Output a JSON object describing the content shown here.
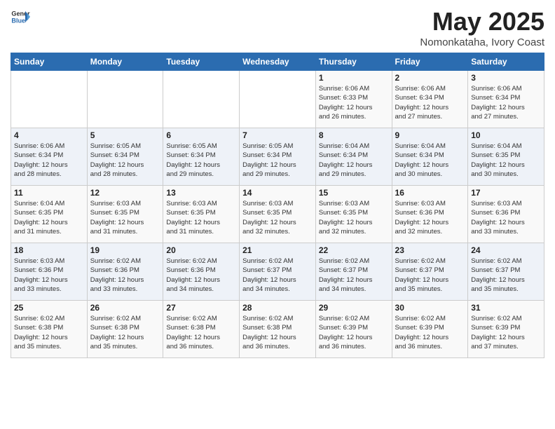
{
  "header": {
    "logo_general": "General",
    "logo_blue": "Blue",
    "title": "May 2025",
    "subtitle": "Nomonkataha, Ivory Coast"
  },
  "weekdays": [
    "Sunday",
    "Monday",
    "Tuesday",
    "Wednesday",
    "Thursday",
    "Friday",
    "Saturday"
  ],
  "weeks": [
    [
      {
        "day": "",
        "info": ""
      },
      {
        "day": "",
        "info": ""
      },
      {
        "day": "",
        "info": ""
      },
      {
        "day": "",
        "info": ""
      },
      {
        "day": "1",
        "info": "Sunrise: 6:06 AM\nSunset: 6:33 PM\nDaylight: 12 hours\nand 26 minutes."
      },
      {
        "day": "2",
        "info": "Sunrise: 6:06 AM\nSunset: 6:34 PM\nDaylight: 12 hours\nand 27 minutes."
      },
      {
        "day": "3",
        "info": "Sunrise: 6:06 AM\nSunset: 6:34 PM\nDaylight: 12 hours\nand 27 minutes."
      }
    ],
    [
      {
        "day": "4",
        "info": "Sunrise: 6:06 AM\nSunset: 6:34 PM\nDaylight: 12 hours\nand 28 minutes."
      },
      {
        "day": "5",
        "info": "Sunrise: 6:05 AM\nSunset: 6:34 PM\nDaylight: 12 hours\nand 28 minutes."
      },
      {
        "day": "6",
        "info": "Sunrise: 6:05 AM\nSunset: 6:34 PM\nDaylight: 12 hours\nand 29 minutes."
      },
      {
        "day": "7",
        "info": "Sunrise: 6:05 AM\nSunset: 6:34 PM\nDaylight: 12 hours\nand 29 minutes."
      },
      {
        "day": "8",
        "info": "Sunrise: 6:04 AM\nSunset: 6:34 PM\nDaylight: 12 hours\nand 29 minutes."
      },
      {
        "day": "9",
        "info": "Sunrise: 6:04 AM\nSunset: 6:34 PM\nDaylight: 12 hours\nand 30 minutes."
      },
      {
        "day": "10",
        "info": "Sunrise: 6:04 AM\nSunset: 6:35 PM\nDaylight: 12 hours\nand 30 minutes."
      }
    ],
    [
      {
        "day": "11",
        "info": "Sunrise: 6:04 AM\nSunset: 6:35 PM\nDaylight: 12 hours\nand 31 minutes."
      },
      {
        "day": "12",
        "info": "Sunrise: 6:03 AM\nSunset: 6:35 PM\nDaylight: 12 hours\nand 31 minutes."
      },
      {
        "day": "13",
        "info": "Sunrise: 6:03 AM\nSunset: 6:35 PM\nDaylight: 12 hours\nand 31 minutes."
      },
      {
        "day": "14",
        "info": "Sunrise: 6:03 AM\nSunset: 6:35 PM\nDaylight: 12 hours\nand 32 minutes."
      },
      {
        "day": "15",
        "info": "Sunrise: 6:03 AM\nSunset: 6:35 PM\nDaylight: 12 hours\nand 32 minutes."
      },
      {
        "day": "16",
        "info": "Sunrise: 6:03 AM\nSunset: 6:36 PM\nDaylight: 12 hours\nand 32 minutes."
      },
      {
        "day": "17",
        "info": "Sunrise: 6:03 AM\nSunset: 6:36 PM\nDaylight: 12 hours\nand 33 minutes."
      }
    ],
    [
      {
        "day": "18",
        "info": "Sunrise: 6:03 AM\nSunset: 6:36 PM\nDaylight: 12 hours\nand 33 minutes."
      },
      {
        "day": "19",
        "info": "Sunrise: 6:02 AM\nSunset: 6:36 PM\nDaylight: 12 hours\nand 33 minutes."
      },
      {
        "day": "20",
        "info": "Sunrise: 6:02 AM\nSunset: 6:36 PM\nDaylight: 12 hours\nand 34 minutes."
      },
      {
        "day": "21",
        "info": "Sunrise: 6:02 AM\nSunset: 6:37 PM\nDaylight: 12 hours\nand 34 minutes."
      },
      {
        "day": "22",
        "info": "Sunrise: 6:02 AM\nSunset: 6:37 PM\nDaylight: 12 hours\nand 34 minutes."
      },
      {
        "day": "23",
        "info": "Sunrise: 6:02 AM\nSunset: 6:37 PM\nDaylight: 12 hours\nand 35 minutes."
      },
      {
        "day": "24",
        "info": "Sunrise: 6:02 AM\nSunset: 6:37 PM\nDaylight: 12 hours\nand 35 minutes."
      }
    ],
    [
      {
        "day": "25",
        "info": "Sunrise: 6:02 AM\nSunset: 6:38 PM\nDaylight: 12 hours\nand 35 minutes."
      },
      {
        "day": "26",
        "info": "Sunrise: 6:02 AM\nSunset: 6:38 PM\nDaylight: 12 hours\nand 35 minutes."
      },
      {
        "day": "27",
        "info": "Sunrise: 6:02 AM\nSunset: 6:38 PM\nDaylight: 12 hours\nand 36 minutes."
      },
      {
        "day": "28",
        "info": "Sunrise: 6:02 AM\nSunset: 6:38 PM\nDaylight: 12 hours\nand 36 minutes."
      },
      {
        "day": "29",
        "info": "Sunrise: 6:02 AM\nSunset: 6:39 PM\nDaylight: 12 hours\nand 36 minutes."
      },
      {
        "day": "30",
        "info": "Sunrise: 6:02 AM\nSunset: 6:39 PM\nDaylight: 12 hours\nand 36 minutes."
      },
      {
        "day": "31",
        "info": "Sunrise: 6:02 AM\nSunset: 6:39 PM\nDaylight: 12 hours\nand 37 minutes."
      }
    ]
  ]
}
